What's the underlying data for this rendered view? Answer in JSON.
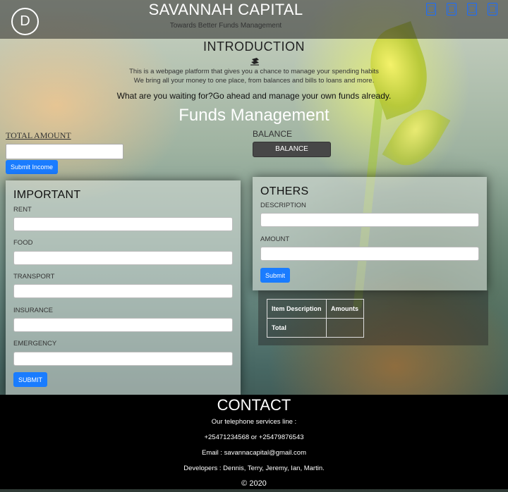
{
  "header": {
    "logo_letter": "D",
    "title": "SAVANNAH CAPITAL",
    "tagline": "Towards Better Funds Management",
    "social_icons": [
      "social-icon-1",
      "social-icon-2",
      "social-icon-3",
      "social-icon-4"
    ],
    "social_glyph": "□"
  },
  "intro": {
    "title": "INTRODUCTION",
    "line1": "This is a webpage platform that gives you a chance to manage your spending habits",
    "line2": "We bring all your money to one place, from balances and bills to loans and more.",
    "cta": "What are you waiting for?Go ahead and manage your own funds already."
  },
  "funds": {
    "title": "Funds Management",
    "total_label": "TOTAL AMOUNT",
    "total_value": "",
    "submit_income": "Submit Income",
    "balance_label": "BALANCE",
    "balance_button": "BALANCE"
  },
  "important": {
    "title": "IMPORTANT",
    "fields": [
      {
        "label": "RENT",
        "value": ""
      },
      {
        "label": "FOOD",
        "value": ""
      },
      {
        "label": "TRANSPORT",
        "value": ""
      },
      {
        "label": "INSURANCE",
        "value": ""
      },
      {
        "label": "EMERGENCY",
        "value": ""
      }
    ],
    "submit": "SUBMIT"
  },
  "others": {
    "title": "OTHERS",
    "description_label": "DESCRIPTION",
    "amount_label": "AMOUNT",
    "submit": "Submit"
  },
  "summary_table": {
    "headers": [
      "Item Description",
      "Amounts"
    ],
    "total_label": "Total",
    "total_value": ""
  },
  "footer": {
    "title": "CONTACT",
    "line1": "Our telephone services line :",
    "line2": "+25471234568 or +25479876543",
    "line3": "Email : savannacapital@gmail.com",
    "line4": "Developers : Dennis, Terry, Jeremy, Ian, Martin.",
    "copyright": "© 2020"
  },
  "colors": {
    "accent": "#1a7cff",
    "header_bg": "#3a3a3a",
    "footer_bg": "#000000",
    "balance_button": "#474747"
  }
}
